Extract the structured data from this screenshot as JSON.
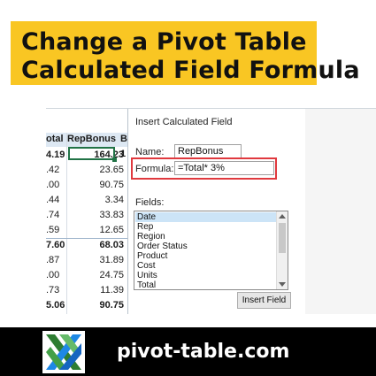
{
  "title": {
    "line1": "Change a Pivot Table",
    "line2": "Calculated Field Formula"
  },
  "spreadsheet": {
    "header_a": "otal",
    "header_b": "RepBonus",
    "header_c": "B",
    "col3_first": "1",
    "rows": [
      {
        "a": "4.19",
        "b": "164.23",
        "bold": true
      },
      {
        "a": ".42",
        "b": "23.65",
        "bold": false
      },
      {
        "a": ".00",
        "b": "90.75",
        "bold": false
      },
      {
        "a": ".44",
        "b": "3.34",
        "bold": false
      },
      {
        "a": ".74",
        "b": "33.83",
        "bold": false
      },
      {
        "a": ".59",
        "b": "12.65",
        "bold": false
      },
      {
        "a": "7.60",
        "b": "68.03",
        "bold": true
      },
      {
        "a": ".87",
        "b": "31.89",
        "bold": false
      },
      {
        "a": ".00",
        "b": "24.75",
        "bold": false
      },
      {
        "a": ".73",
        "b": "11.39",
        "bold": false
      },
      {
        "a": "5.06",
        "b": "90.75",
        "bold": true
      }
    ]
  },
  "dialog": {
    "title": "Insert Calculated Field",
    "name_label": "Name:",
    "name_value": "RepBonus",
    "formula_label": "Formula:",
    "formula_value": "=Total* 3%",
    "fields_label": "Fields:",
    "fields": [
      "Date",
      "Rep",
      "Region",
      "Order Status",
      "Product",
      "Cost",
      "Units",
      "Total"
    ],
    "selected_field": "Date",
    "insert_button": "Insert Field"
  },
  "footer": {
    "site": "pivot-table.com"
  },
  "colors": {
    "title_bg": "#f9c623",
    "highlight": "#e0393e",
    "selection": "#217346",
    "footer_bg": "#000000"
  }
}
